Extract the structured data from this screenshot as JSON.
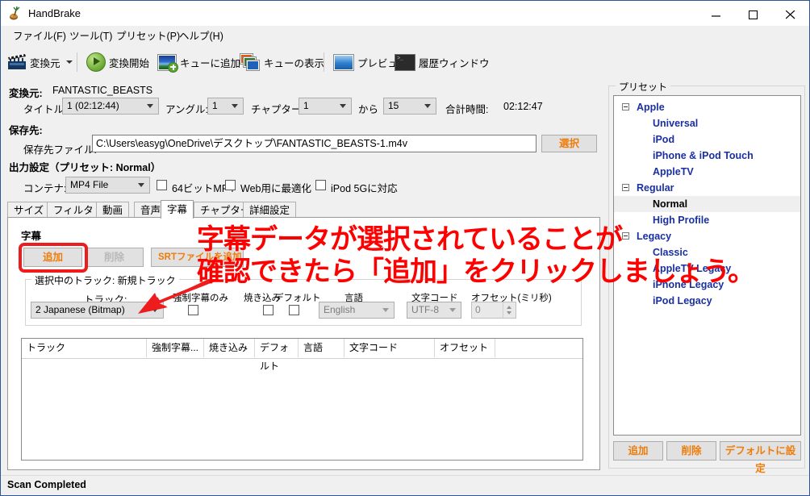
{
  "window": {
    "title": "HandBrake",
    "app_icon": "handbrake-icon",
    "controls": {
      "minimize": "minimize-icon",
      "maximize": "maximize-icon",
      "close": "close-icon"
    }
  },
  "menu": {
    "items": [
      "ファイル(F)",
      "ツール(T)",
      "プリセット(P)",
      "ヘルプ(H)"
    ]
  },
  "toolbar": {
    "items": [
      {
        "label": "変換元",
        "icon": "clapperboard-icon",
        "dropdown": true
      },
      {
        "label": "変換開始",
        "icon": "play-icon",
        "dropdown": false
      },
      {
        "label": "キューに追加",
        "icon": "add-to-queue-icon",
        "dropdown": false
      },
      {
        "label": "キューの表示",
        "icon": "show-queue-icon",
        "dropdown": false
      },
      {
        "label": "プレビュー",
        "icon": "preview-icon",
        "dropdown": false
      },
      {
        "label": "履歴ウィンドウ",
        "icon": "activity-log-icon",
        "dropdown": false
      }
    ]
  },
  "source": {
    "label": "変換元:",
    "name": "FANTASTIC_BEASTS",
    "title_label": "タイトル:",
    "title_value": "1 (02:12:44)",
    "angle_label": "アングル:",
    "angle_value": "1",
    "chapter_label": "チャプター:",
    "chapter_from": "1",
    "chapter_to_label": "から",
    "chapter_to": "15",
    "duration_label": "合計時間:",
    "duration_value": "02:12:47"
  },
  "destination": {
    "label": "保存先:",
    "file_label": "保存先ファイル:",
    "file_value": "C:\\Users\\easyg\\OneDrive\\デスクトップ\\FANTASTIC_BEASTS-1.m4v",
    "browse_button": "選択"
  },
  "output": {
    "label": "出力設定（プリセット: Normal）",
    "container_label": "コンテナ:",
    "container_value": "MP4 File",
    "checkboxes": [
      {
        "label": "64ビットMP4",
        "checked": false
      },
      {
        "label": "Web用に最適化",
        "checked": false
      },
      {
        "label": "iPod 5Gに対応",
        "checked": false
      }
    ]
  },
  "tabs": {
    "items": [
      "サイズ",
      "フィルタ",
      "動画",
      "音声",
      "字幕",
      "チャプター",
      "詳細設定"
    ],
    "active_index": 4
  },
  "subtitles": {
    "section_title": "字幕",
    "buttons": {
      "add": "追加",
      "remove": "削除",
      "srt": "SRTファイルを追加"
    },
    "group_title": "選択中のトラック: 新規トラック",
    "fields": {
      "track_label": "トラック:",
      "track_value": "2 Japanese (Bitmap)",
      "forced_label": "強制字幕のみ",
      "forced_checked": false,
      "burn_label": "焼き込み",
      "burn_checked": false,
      "default_label": "デフォルト",
      "default_checked": false,
      "language_label": "言語",
      "language_value": "English",
      "charcode_label": "文字コード",
      "charcode_value": "UTF-8",
      "offset_label": "オフセット(ミリ秒)",
      "offset_value": "0"
    },
    "table": {
      "columns": [
        "トラック",
        "強制字幕...",
        "焼き込み",
        "デフォルト",
        "言語",
        "文字コード",
        "オフセット"
      ],
      "rows": []
    }
  },
  "presets": {
    "group_title": "プリセット",
    "tree": [
      {
        "label": "Apple",
        "level": 0,
        "expandable": true,
        "selected": false
      },
      {
        "label": "Universal",
        "level": 1,
        "expandable": false,
        "selected": false
      },
      {
        "label": "iPod",
        "level": 1,
        "expandable": false,
        "selected": false
      },
      {
        "label": "iPhone & iPod Touch",
        "level": 1,
        "expandable": false,
        "selected": false
      },
      {
        "label": "AppleTV",
        "level": 1,
        "expandable": false,
        "selected": false
      },
      {
        "label": "Regular",
        "level": 0,
        "expandable": true,
        "selected": false
      },
      {
        "label": "Normal",
        "level": 1,
        "expandable": false,
        "selected": true
      },
      {
        "label": "High Profile",
        "level": 1,
        "expandable": false,
        "selected": false
      },
      {
        "label": "Legacy",
        "level": 0,
        "expandable": true,
        "selected": false
      },
      {
        "label": "Classic",
        "level": 1,
        "expandable": false,
        "selected": false
      },
      {
        "label": "AppleTV Legacy",
        "level": 1,
        "expandable": false,
        "selected": false
      },
      {
        "label": "iPhone Legacy",
        "level": 1,
        "expandable": false,
        "selected": false
      },
      {
        "label": "iPod Legacy",
        "level": 1,
        "expandable": false,
        "selected": false
      }
    ],
    "buttons": [
      "追加",
      "削除",
      "デフォルトに設定"
    ]
  },
  "statusbar": {
    "text": "Scan Completed"
  },
  "annotations": {
    "line1": "字幕データが選択されていることが",
    "line2": "確認できたら「追加」をクリックしましょう。",
    "color": "#ff0000",
    "highlight_target": "add-subtitle-button",
    "arrow_target": "subtitle-track-combo"
  }
}
